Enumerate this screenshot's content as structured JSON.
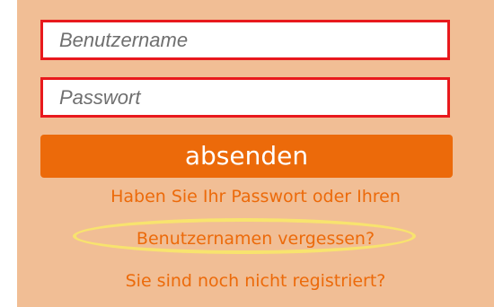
{
  "form": {
    "username": {
      "value": "",
      "placeholder": "Benutzername"
    },
    "password": {
      "value": "",
      "placeholder": "Passwort"
    },
    "submit_label": "absenden"
  },
  "links": {
    "forgot_line1": "Haben Sie Ihr Passwort oder Ihren",
    "forgot_line2": "Benutzernamen vergessen?",
    "register": "Sie sind noch nicht registriert?"
  },
  "colors": {
    "background": "#f1be95",
    "accent": "#ec6a0a",
    "field_border": "#e8191d",
    "highlight": "#f8e36e"
  }
}
